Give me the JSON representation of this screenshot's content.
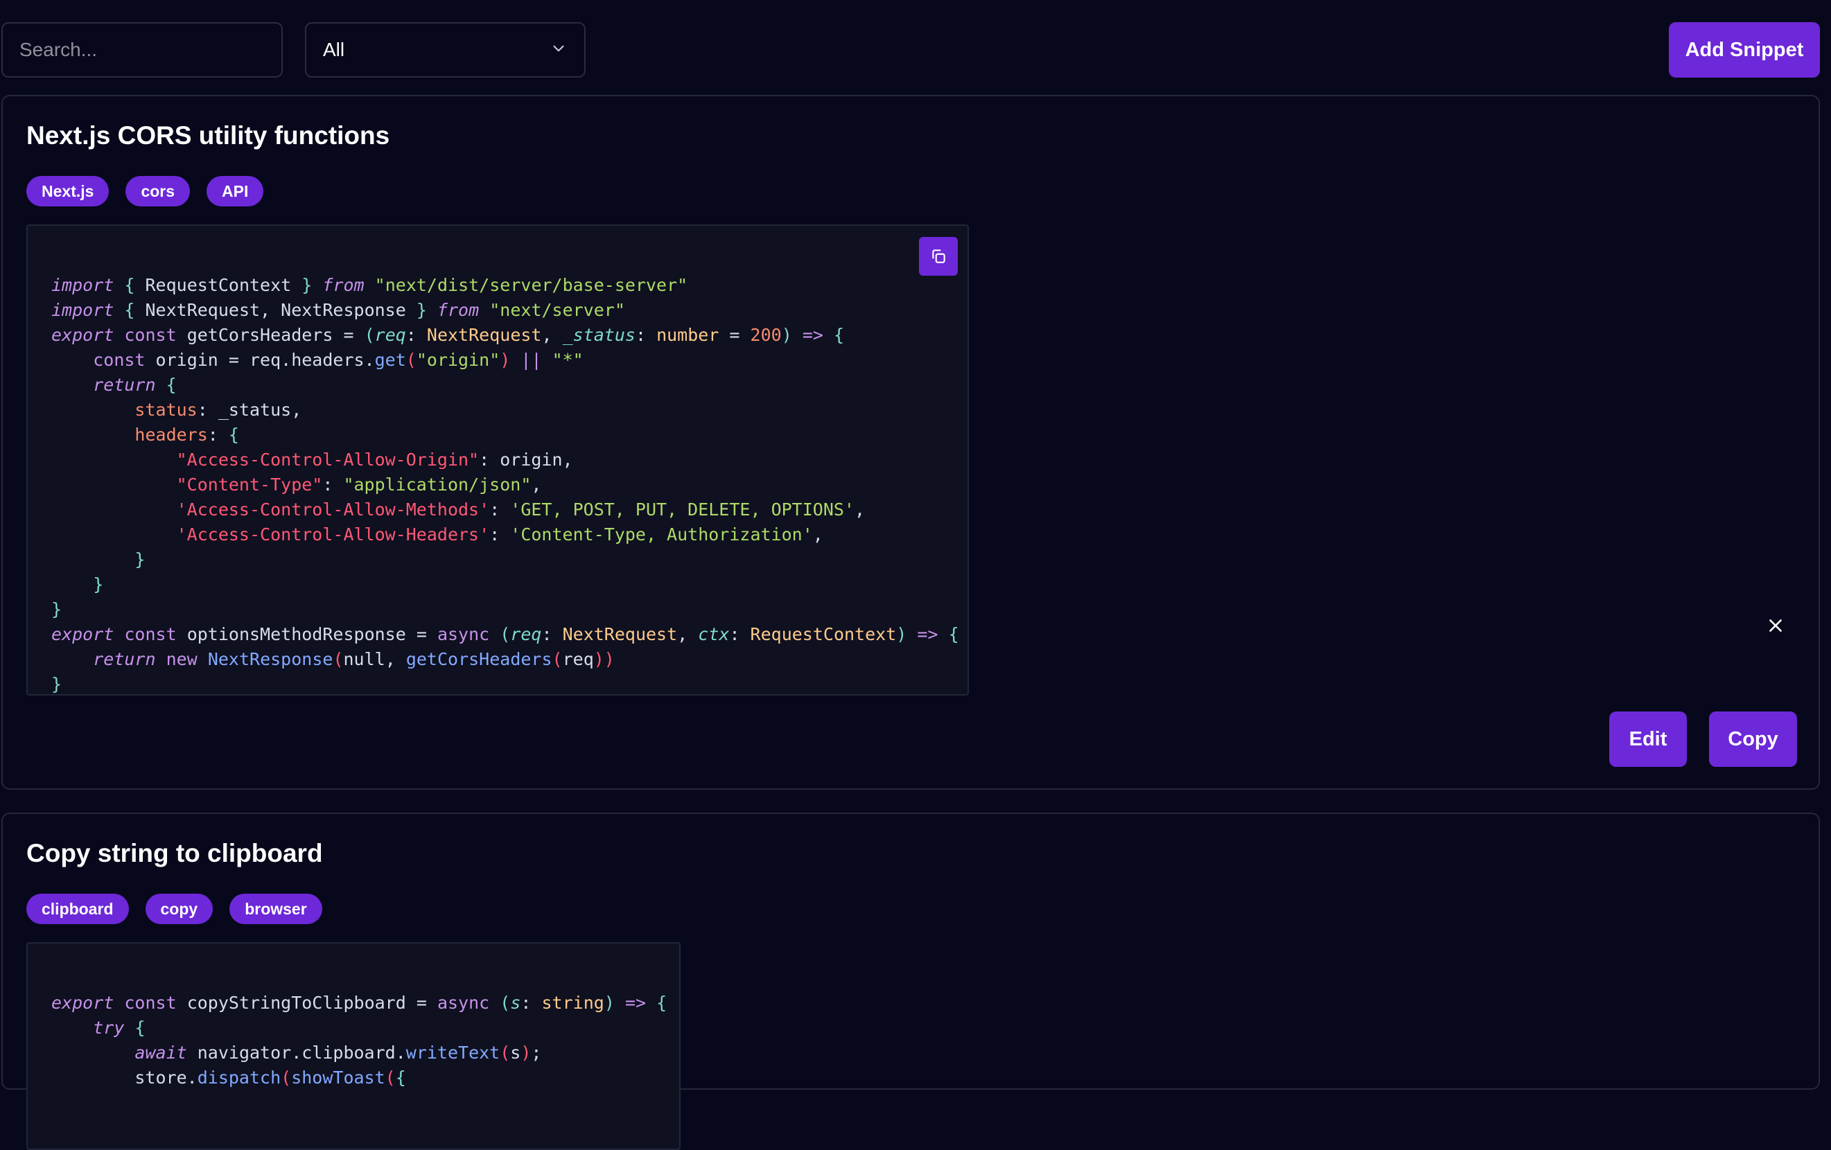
{
  "toolbar": {
    "search_placeholder": "Search...",
    "search_value": "",
    "filter_selected": "All",
    "add_button": "Add Snippet"
  },
  "snippets": [
    {
      "title": "Next.js CORS utility functions",
      "tags": [
        "Next.js",
        "cors",
        "API"
      ],
      "code_lines": [
        "import { RequestContext } from \"next/dist/server/base-server\"",
        "import { NextRequest, NextResponse } from \"next/server\"",
        "export const getCorsHeaders = (req: NextRequest, _status: number = 200) => {",
        "    const origin = req.headers.get(\"origin\") || \"*\"",
        "    return {",
        "        status: _status,",
        "        headers: {",
        "            \"Access-Control-Allow-Origin\": origin,",
        "            \"Content-Type\": \"application/json\",",
        "            'Access-Control-Allow-Methods': 'GET, POST, PUT, DELETE, OPTIONS',",
        "            'Access-Control-Allow-Headers': 'Content-Type, Authorization',",
        "        }",
        "    }",
        "}",
        "export const optionsMethodResponse = async (req: NextRequest, ctx: RequestContext) => {",
        "    return new NextResponse(null, getCorsHeaders(req))",
        "}"
      ],
      "edit_label": "Edit",
      "copy_label": "Copy"
    },
    {
      "title": "Copy string to clipboard",
      "tags": [
        "clipboard",
        "copy",
        "browser"
      ],
      "code_lines": [
        "export const copyStringToClipboard = async (s: string) => {",
        "    try {",
        "        await navigator.clipboard.writeText(s);",
        "        store.dispatch(showToast({"
      ]
    }
  ],
  "colors": {
    "background": "#07081b",
    "accent": "#6d28d9",
    "card_border": "#262838",
    "code_background": "#0f1020"
  },
  "icons": {
    "select_chevron": "chevron-down-icon",
    "code_copy": "copy-icon",
    "close": "close-icon"
  }
}
